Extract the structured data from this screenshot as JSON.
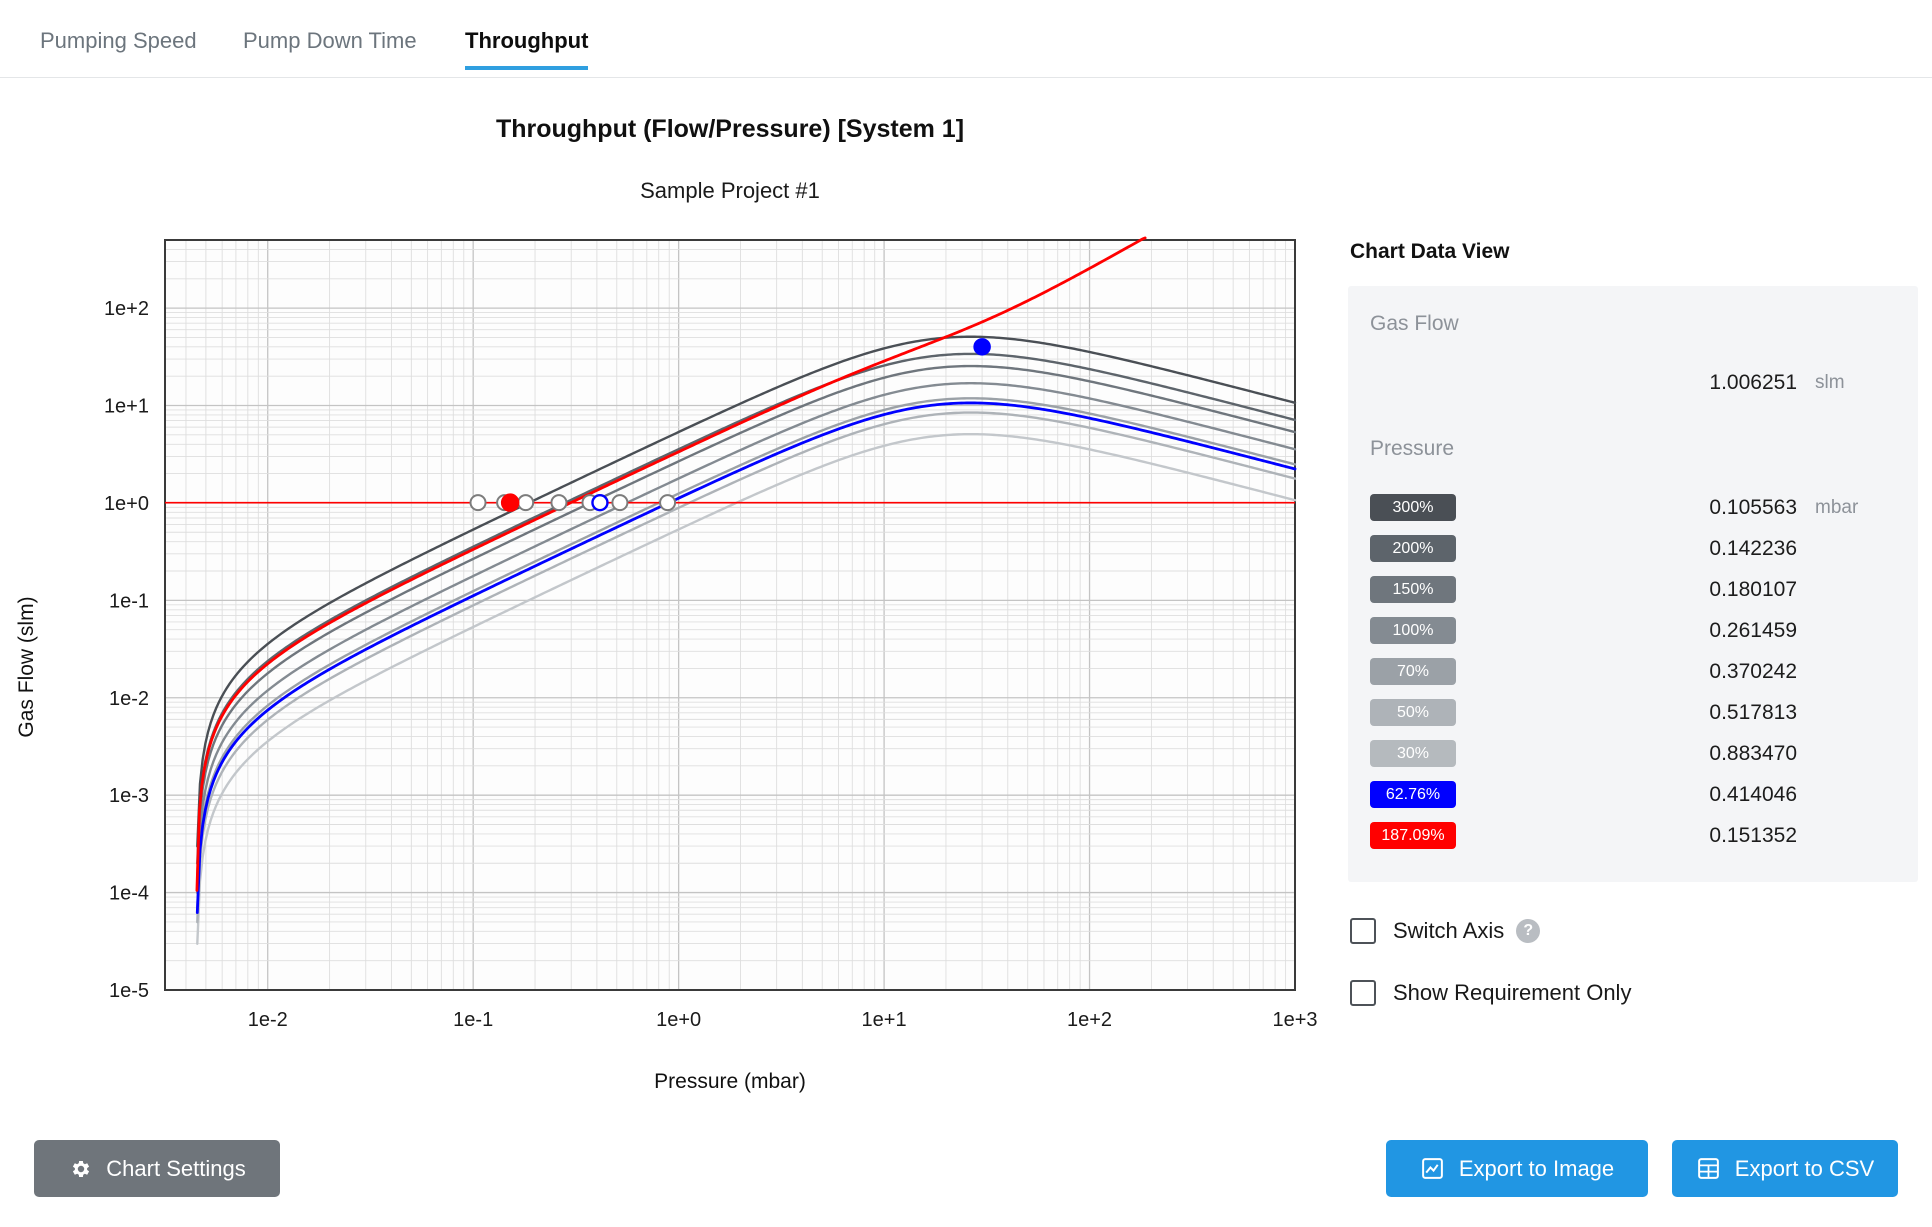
{
  "tabs": [
    {
      "label": "Pumping Speed",
      "active": false
    },
    {
      "label": "Pump Down Time",
      "active": false
    },
    {
      "label": "Throughput",
      "active": true
    }
  ],
  "header": {
    "title": "Throughput (Flow/Pressure) [System 1]",
    "subtitle": "Sample Project #1"
  },
  "chart_data": {
    "type": "line",
    "title": "Throughput (Flow/Pressure) [System 1]",
    "subtitle": "Sample Project #1",
    "xlabel": "Pressure (mbar)",
    "ylabel": "Gas Flow (slm)",
    "xscale": "log",
    "yscale": "log",
    "xlim": [
      0.0031623,
      1000
    ],
    "ylim": [
      1e-05,
      500
    ],
    "xticks": [
      "1e-2",
      "1e-1",
      "1e+0",
      "1e+1",
      "1e+2",
      "1e+3"
    ],
    "xtick_values": [
      0.01,
      0.1,
      1,
      10,
      100,
      1000
    ],
    "yticks": [
      "1e+2",
      "1e+1",
      "1e+0",
      "1e-1",
      "1e-2",
      "1e-3",
      "1e-4",
      "1e-5"
    ],
    "ytick_values": [
      100,
      10,
      1,
      0.1,
      0.01,
      0.001,
      0.0001,
      1e-05
    ],
    "grid": true,
    "legend": "none",
    "requirement_line": {
      "value": 1.006251,
      "unit": "slm",
      "color": "#ff0000"
    },
    "series": [
      {
        "name": "300%",
        "color": "#4a4f55",
        "width": 2.4,
        "crossing_pressure": 0.105563
      },
      {
        "name": "200%",
        "color": "#5d646b",
        "width": 2.4,
        "crossing_pressure": 0.142236
      },
      {
        "name": "150%",
        "color": "#6f767d",
        "width": 2.4,
        "crossing_pressure": 0.180107
      },
      {
        "name": "100%",
        "color": "#848b92",
        "width": 2.4,
        "crossing_pressure": 0.261459
      },
      {
        "name": "70%",
        "color": "#9ba1a7",
        "width": 2.4,
        "crossing_pressure": 0.370242
      },
      {
        "name": "50%",
        "color": "#aeb3b8",
        "width": 2.4,
        "crossing_pressure": 0.517813
      },
      {
        "name": "30%",
        "color": "#c3c7cb",
        "width": 2.4,
        "crossing_pressure": 0.88347
      },
      {
        "name": "62.76%",
        "color": "#0000ff",
        "width": 2.8,
        "crossing_pressure": 0.414046
      },
      {
        "name": "187.09%",
        "color": "#ff0000",
        "width": 2.8,
        "crossing_pressure": 0.151352
      }
    ],
    "markers": [
      {
        "series": "187.09%",
        "pressure": 0.151352,
        "flow": 1.006251,
        "color": "#ff0000",
        "filled": true
      },
      {
        "series": "62.76%",
        "pressure": 0.414046,
        "flow": 1.006251,
        "color": "#0000ff",
        "filled": false
      },
      {
        "series": "62.76%",
        "pressure": 30.0,
        "flow": 40.0,
        "color": "#0000ff",
        "filled": true
      }
    ]
  },
  "side": {
    "title": "Chart Data View",
    "gas_flow": {
      "label": "Gas Flow",
      "value": "1.006251",
      "unit": "slm"
    },
    "pressure": {
      "label": "Pressure",
      "unit": "mbar",
      "rows": [
        {
          "badge": "300%",
          "value": "0.105563",
          "color": "#4a4f55"
        },
        {
          "badge": "200%",
          "value": "0.142236",
          "color": "#5d646b"
        },
        {
          "badge": "150%",
          "value": "0.180107",
          "color": "#6f767d"
        },
        {
          "badge": "100%",
          "value": "0.261459",
          "color": "#848b92"
        },
        {
          "badge": "70%",
          "value": "0.370242",
          "color": "#9ba1a7"
        },
        {
          "badge": "50%",
          "value": "0.517813",
          "color": "#aeb3b8"
        },
        {
          "badge": "30%",
          "value": "0.883470",
          "color": "#b5babe"
        },
        {
          "badge": "62.76%",
          "value": "0.414046",
          "color": "#0000ff"
        },
        {
          "badge": "187.09%",
          "value": "0.151352",
          "color": "#ff0000"
        }
      ]
    },
    "checkboxes": [
      {
        "label": "Switch Axis",
        "checked": false,
        "help": "?"
      },
      {
        "label": "Show Requirement Only",
        "checked": false
      }
    ]
  },
  "footer": {
    "settings_label": "Chart Settings",
    "export_image_label": "Export to Image",
    "export_csv_label": "Export to CSV"
  }
}
